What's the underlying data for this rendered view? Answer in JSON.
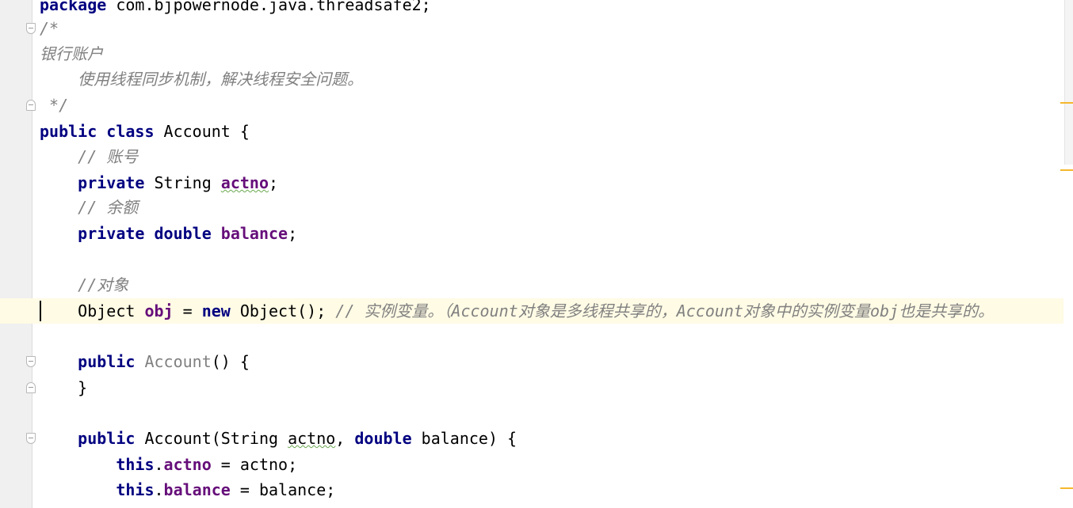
{
  "editor": {
    "lines": {
      "package_kw": "package",
      "package_name": " com.bjpowernode.java.threadsafe2;",
      "doc_open": "/*",
      "doc_title": "银行账户",
      "doc_desc": "    使用线程同步机制，解决线程安全问题。",
      "doc_close": " */",
      "class_public": "public",
      "class_kw": "class",
      "class_name": " Account {",
      "cmt_actno": "    // 账号",
      "actno_private": "    private",
      "actno_type": " String ",
      "actno_name": "actno",
      "actno_semi": ";",
      "cmt_balance": "    // 余额",
      "balance_private": "    private",
      "balance_type": "double",
      "balance_name": "balance",
      "balance_semi": ";",
      "cmt_obj": "    //对象",
      "obj_type": "    Object ",
      "obj_name": "obj",
      "obj_eq": " = ",
      "obj_new": "new",
      "obj_ctor": " Object(); ",
      "obj_comment": "// 实例变量。（Account对象是多线程共享的，Account对象中的实例变量obj也是共享的。",
      "ctor1_public": "    public",
      "ctor1_name": "Account",
      "ctor1_rest": "() {",
      "ctor1_close": "    }",
      "ctor2_public": "    public",
      "ctor2_name": " Account(String ",
      "ctor2_param1": "actno",
      "ctor2_sep": ", ",
      "ctor2_double": "double",
      "ctor2_rest": " balance) {",
      "assign1_this": "        this",
      "assign1_dot": ".",
      "assign1_field": "actno",
      "assign1_rest": " = actno;",
      "assign2_this": "        this",
      "assign2_dot": ".",
      "assign2_field": "balance",
      "assign2_rest": " = balance;"
    }
  }
}
